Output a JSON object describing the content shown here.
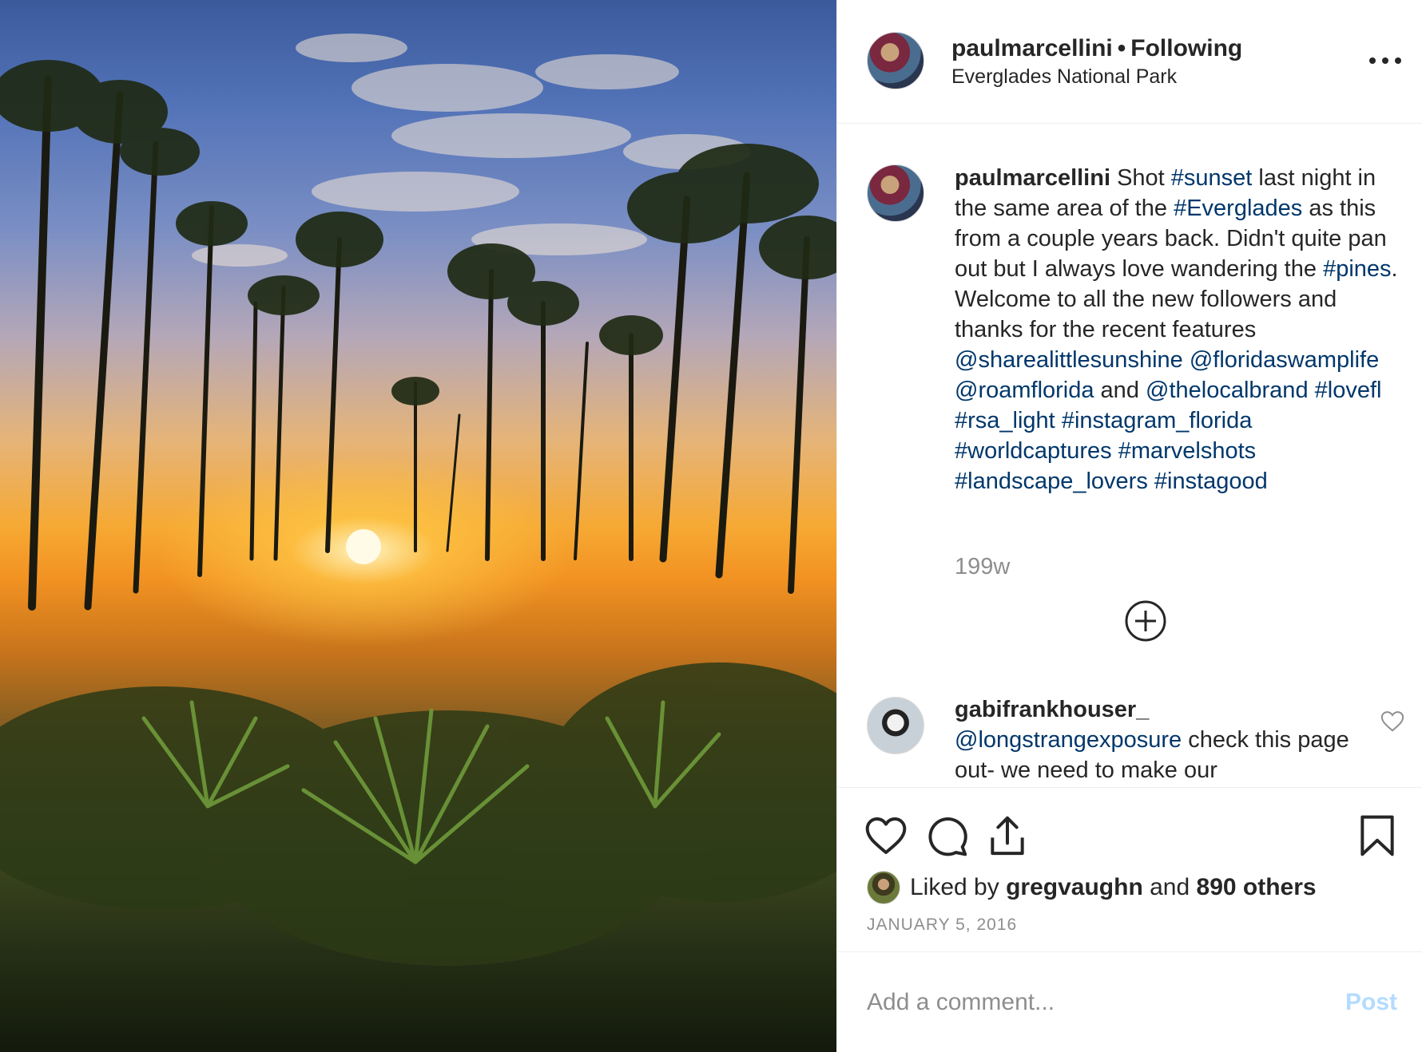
{
  "header": {
    "username": "paulmarcellini",
    "separator": "•",
    "follow_status": "Following",
    "location": "Everglades National Park"
  },
  "caption": {
    "username": "paulmarcellini",
    "segments": [
      {
        "type": "text",
        "value": " Shot "
      },
      {
        "type": "tag",
        "value": "#sunset"
      },
      {
        "type": "text",
        "value": " last night in the same area of the "
      },
      {
        "type": "tag",
        "value": "#Everglades"
      },
      {
        "type": "text",
        "value": " as this from a couple years back. Didn't quite pan out but I always love wandering the "
      },
      {
        "type": "tag",
        "value": "#pines"
      },
      {
        "type": "text",
        "value": ". Welcome to all the new followers and thanks for the recent features "
      },
      {
        "type": "tag",
        "value": "@sharealittlesunshine"
      },
      {
        "type": "text",
        "value": " "
      },
      {
        "type": "tag",
        "value": "@floridaswamplife"
      },
      {
        "type": "text",
        "value": " "
      },
      {
        "type": "tag",
        "value": "@roamflorida"
      },
      {
        "type": "text",
        "value": " and "
      },
      {
        "type": "tag",
        "value": "@thelocalbrand"
      },
      {
        "type": "text",
        "value": " "
      },
      {
        "type": "tag",
        "value": "#lovefl"
      },
      {
        "type": "text",
        "value": " "
      },
      {
        "type": "tag",
        "value": "#rsa_light"
      },
      {
        "type": "text",
        "value": " "
      },
      {
        "type": "tag",
        "value": "#instagram_florida"
      },
      {
        "type": "text",
        "value": " "
      },
      {
        "type": "tag",
        "value": "#worldcaptures"
      },
      {
        "type": "text",
        "value": " "
      },
      {
        "type": "tag",
        "value": "#marvelshots"
      },
      {
        "type": "text",
        "value": " "
      },
      {
        "type": "tag",
        "value": "#landscape_lovers"
      },
      {
        "type": "text",
        "value": " "
      },
      {
        "type": "tag",
        "value": "#instagood"
      }
    ],
    "time": "199w"
  },
  "comment": {
    "username": "gabifrankhouser_",
    "mention": "@longstrangexposure",
    "text": " check this page out- we need to make our"
  },
  "actions": {
    "liked_prefix": "Liked by ",
    "liked_user": "gregvaughn",
    "liked_mid": " and ",
    "liked_others": "890 others",
    "date": "JANUARY 5, 2016"
  },
  "add_comment": {
    "placeholder": "Add a comment...",
    "post_label": "Post"
  },
  "icons": {
    "more": "more-options-icon",
    "plus": "load-more-comments-icon",
    "heart": "heart-icon",
    "comment": "comment-icon",
    "share": "share-icon",
    "save": "bookmark-icon"
  },
  "colors": {
    "tag": "#00376b",
    "muted": "#8e8e8e",
    "post_disabled": "#b3dbff",
    "border": "#efefef"
  }
}
